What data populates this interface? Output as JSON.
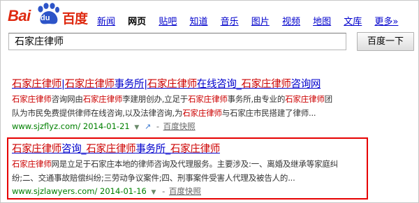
{
  "logo": {
    "text_left": "Bai",
    "text_paw": "du",
    "text_cn": "百度"
  },
  "nav": [
    {
      "label": "新闻",
      "active": false
    },
    {
      "label": "网页",
      "active": true
    },
    {
      "label": "贴吧",
      "active": false
    },
    {
      "label": "知道",
      "active": false
    },
    {
      "label": "音乐",
      "active": false
    },
    {
      "label": "图片",
      "active": false
    },
    {
      "label": "视频",
      "active": false
    },
    {
      "label": "地图",
      "active": false
    },
    {
      "label": "文库",
      "active": false
    },
    {
      "label": "更多»",
      "active": false
    }
  ],
  "search": {
    "value": "石家庄律师",
    "button_label": "百度一下"
  },
  "results": [
    {
      "title": [
        [
          "石家庄律师",
          true
        ],
        [
          "|",
          false
        ],
        [
          "石家庄律师",
          true
        ],
        [
          "事务所|",
          false
        ],
        [
          "石家庄律师",
          true
        ],
        [
          "在线咨询_",
          false
        ],
        [
          "石家庄律师",
          true
        ],
        [
          "咨询网",
          false
        ]
      ],
      "abstract_lines": [
        [
          [
            "石家庄律师",
            true
          ],
          [
            "咨询网由",
            false
          ],
          [
            "石家庄律师",
            true
          ],
          [
            "李建朋创办,立足于",
            false
          ],
          [
            "石家庄律师",
            true
          ],
          [
            "事务所,由专业的",
            false
          ],
          [
            "石家庄律师",
            true
          ],
          [
            "团",
            false
          ]
        ],
        [
          [
            "队为市民免费提供律师在线咨询,以及法律咨询,为",
            false
          ],
          [
            "石家庄律师",
            true
          ],
          [
            "与石家庄市民搭建了律师...",
            false
          ]
        ]
      ],
      "url": "www.sjzflyz.com/ 2014-01-21",
      "snapshot": "百度快照"
    },
    {
      "title": [
        [
          "石家庄律师",
          true
        ],
        [
          "咨询_",
          false
        ],
        [
          "石家庄律师",
          true
        ],
        [
          "事务所_",
          false
        ],
        [
          "石家庄律师",
          true
        ]
      ],
      "abstract_lines": [
        [
          [
            "石家庄律师",
            true
          ],
          [
            "网是立足于石家庄本地的律师咨询及代理服务。主要涉及:一、离婚及继承等家庭纠",
            false
          ]
        ],
        [
          [
            "纷;二、交通事故赔偿纠纷;三劳动争议案件;四、刑事案件受害人代理及被告人的...",
            false
          ]
        ]
      ],
      "url": "www.sjzlawyers.com/ 2014-01-16",
      "snapshot": "百度快照"
    }
  ],
  "colors": {
    "brand_red": "#de2910",
    "link_blue": "#0000cc",
    "keyword_red": "#cc0000",
    "url_green": "#008000",
    "highlight_box": "#e60000"
  }
}
